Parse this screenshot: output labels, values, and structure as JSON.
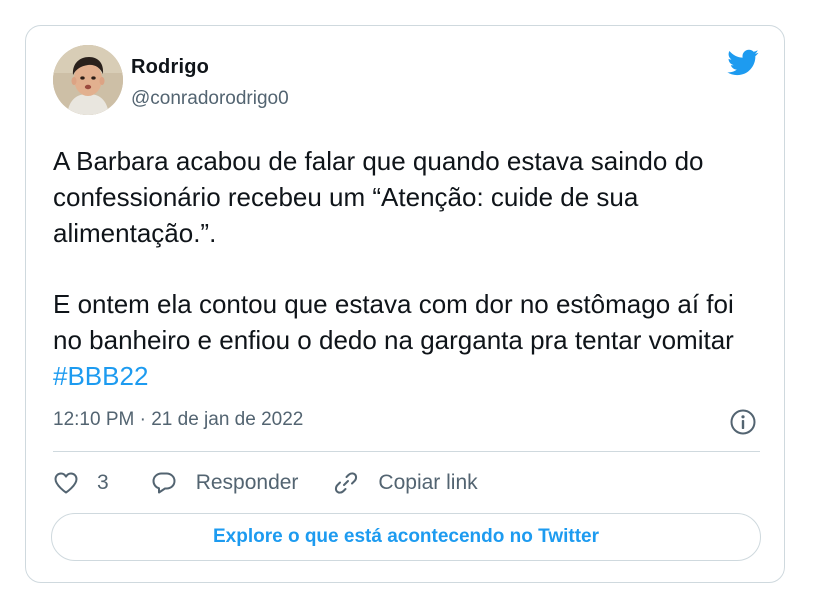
{
  "author": {
    "display_name": "Rodrigo",
    "handle": "@conradorodrigo0"
  },
  "tweet": {
    "paragraph_1": "A Barbara acabou de falar que quando estava saindo do confessionário recebeu um “Atenção: cuide de sua alimentação.”.",
    "paragraph_2_text": " E ontem ela contou que estava com dor no estômago aí foi no banheiro e enfiou o dedo na garganta pra tentar vomitar ",
    "hashtag": "#BBB22",
    "timestamp": "12:10 PM · 21 de jan de 2022"
  },
  "actions": {
    "like_count": "3",
    "reply_label": "Responder",
    "copy_link_label": "Copiar link"
  },
  "explore_label": "Explore o que está acontecendo no Twitter",
  "icons": {
    "brand": "twitter-bird-icon",
    "info": "info-icon",
    "like": "heart-icon",
    "reply": "speech-bubble-icon",
    "copy": "link-icon"
  },
  "colors": {
    "brand": "#1d9bf0",
    "text": "#0f1419",
    "secondary_text": "#536471",
    "border": "#cfd9de"
  }
}
